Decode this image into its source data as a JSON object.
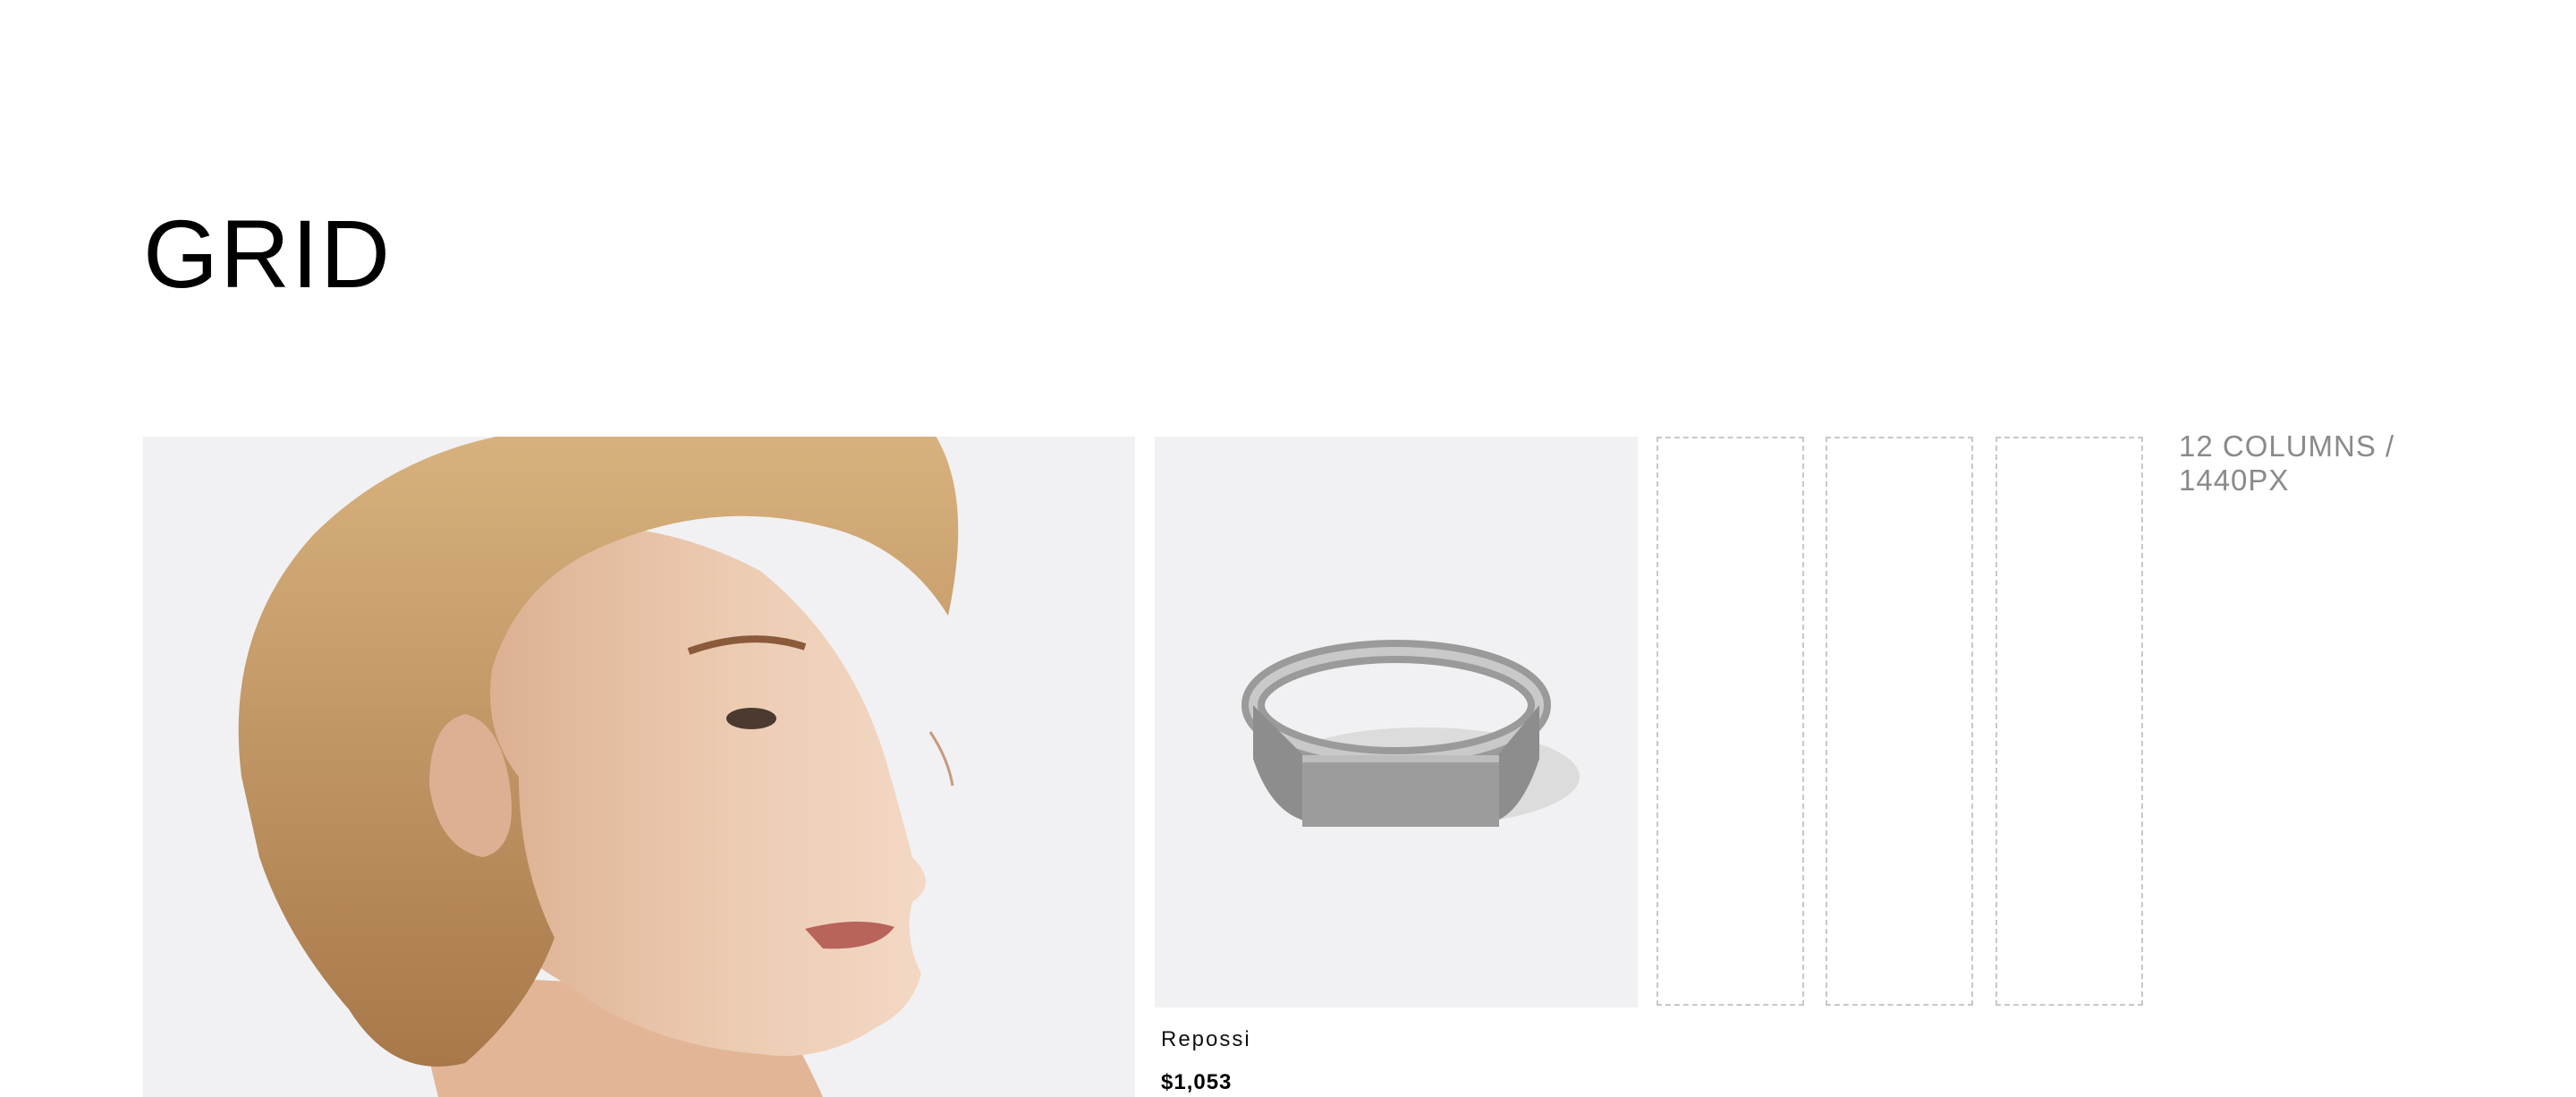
{
  "header": {
    "title": "GRID"
  },
  "product": {
    "name": "Repossi",
    "price": "$1,053"
  },
  "grid": {
    "caption": "12 COLUMNS / 1440PX",
    "placeholder_columns": 3
  },
  "colors": {
    "image_bg": "#f1f1f3",
    "dashed_border": "#c8c8c8",
    "caption": "#8a8a8a"
  }
}
